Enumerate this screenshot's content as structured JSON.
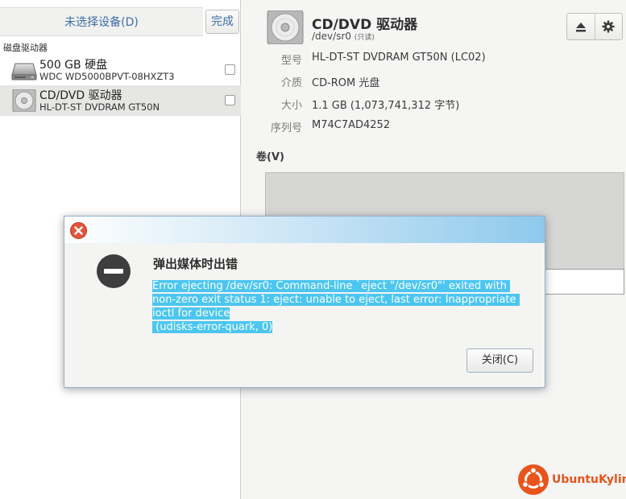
{
  "sidebar": {
    "title": "未选择设备(D)",
    "done_label": "完成",
    "section_label": "磁盘驱动器",
    "drives": [
      {
        "name": "500 GB 硬盘",
        "model": "WDC WD5000BPVT-08HXZT3",
        "icon": "hard-disk-icon",
        "selected": false
      },
      {
        "name": "CD/DVD 驱动器",
        "model": "HL-DT-ST DVDRAM GT50N",
        "icon": "optical-disc-icon",
        "selected": true
      }
    ]
  },
  "detail": {
    "title": "CD/DVD 驱动器",
    "path": "/dev/sr0",
    "readonly": "(只读)",
    "properties": [
      {
        "key": "型号",
        "value": "HL-DT-ST DVDRAM GT50N (LC02)"
      },
      {
        "key": "介质",
        "value": "CD-ROM 光盘"
      },
      {
        "key": "大小",
        "value": "1.1 GB (1,073,741,312 字节)"
      },
      {
        "key": "序列号",
        "value": "M74C7AD4252"
      }
    ],
    "volumes_label": "卷(V)",
    "eject_icon": "eject-icon",
    "settings_icon": "gear-icon"
  },
  "dialog": {
    "heading": "弹出媒体时出错",
    "message": "Error ejecting /dev/sr0: Command-line `eject \"/dev/sr0\"' exited with non-zero exit status 1: eject: unable to eject, last error: Inappropriate ioctl for device\n (udisks-error-quark, 0)",
    "close_label": "关闭(C)",
    "colors": {
      "selection": "#4cc6f0",
      "close_icon": "#e4533b"
    }
  },
  "logo": {
    "text": "UbuntuKylin",
    "color": "#e8541b"
  }
}
